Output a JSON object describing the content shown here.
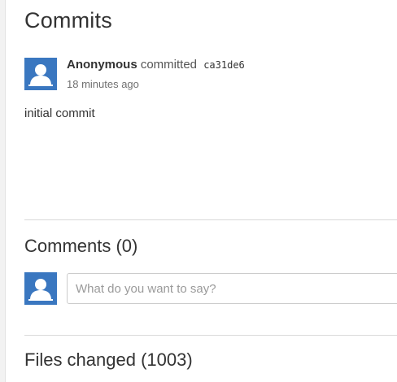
{
  "commits_section": {
    "title": "Commits",
    "commit": {
      "author": "Anonymous",
      "action": "committed",
      "sha": "ca31de6",
      "time_ago": "18 minutes ago",
      "message": "initial commit",
      "avatar_icon": "user-silhouette-icon"
    }
  },
  "comments_section": {
    "title": "Comments (0)",
    "input_placeholder": "What do you want to say?",
    "input_value": "",
    "avatar_icon": "user-silhouette-icon"
  },
  "files_section": {
    "title": "Files changed (1003)"
  },
  "colors": {
    "avatar_bg": "#3a77c0",
    "text": "#333333",
    "divider": "#d9d9d9"
  }
}
